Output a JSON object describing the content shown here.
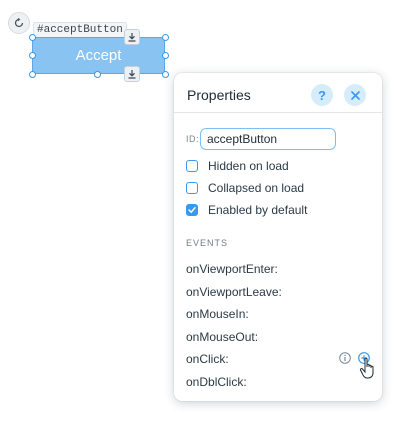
{
  "canvas": {
    "element_id_tag": "#acceptButton",
    "button_label": "Accept"
  },
  "properties_panel": {
    "title": "Properties",
    "help_label": "?",
    "id_label": "ID:",
    "id_value": "acceptButton",
    "checkboxes": [
      {
        "label": "Hidden on load",
        "checked": false
      },
      {
        "label": "Collapsed on load",
        "checked": false
      },
      {
        "label": "Enabled by default",
        "checked": true
      }
    ],
    "events_header": "EVENTS",
    "events": [
      {
        "label": "onViewportEnter:"
      },
      {
        "label": "onViewportLeave:"
      },
      {
        "label": "onMouseIn:"
      },
      {
        "label": "onMouseOut:"
      },
      {
        "label": "onClick:"
      },
      {
        "label": "onDblClick:"
      }
    ]
  },
  "colors": {
    "accent": "#3899ec",
    "button_fill": "#88c3f1",
    "help_bg": "#d6ecfb"
  },
  "icons": [
    "rotate-icon",
    "download-icon",
    "help-icon",
    "close-icon",
    "info-icon",
    "add-icon",
    "hand-cursor-icon"
  ]
}
